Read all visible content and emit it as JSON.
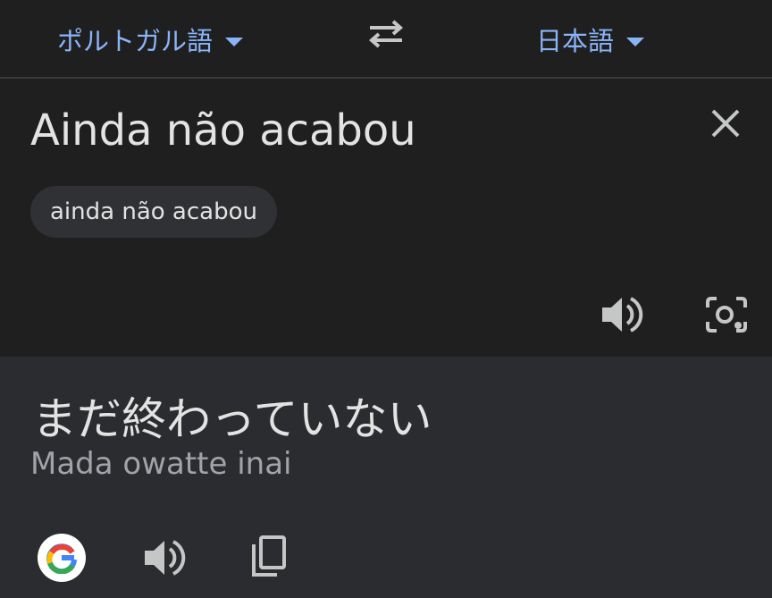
{
  "header": {
    "source_language": "ポルトガル語",
    "target_language": "日本語",
    "swap_icon": "swap-arrows-icon"
  },
  "input": {
    "text": "Ainda não acabou",
    "suggestion_chip": "ainda não acabou",
    "icons": [
      "close-icon",
      "speaker-icon",
      "lens-camera-icon"
    ]
  },
  "output": {
    "translation": "まだ終わっていない",
    "romanization": "Mada owatte inai",
    "icons": [
      "google-logo-icon",
      "speaker-icon",
      "copy-icon"
    ]
  },
  "colors": {
    "accent": "#8ab4f8",
    "background": "#1f1f1f",
    "output_background": "#2b2c2f",
    "icon": "#c4c7c5"
  }
}
